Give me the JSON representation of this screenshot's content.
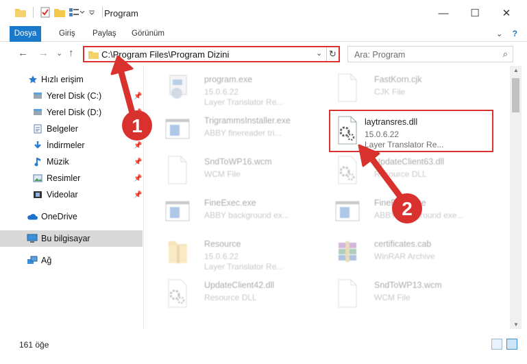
{
  "window": {
    "title": "Program",
    "minimize_glyph": "—",
    "maximize_glyph": "☐",
    "close_glyph": "✕"
  },
  "ribbon": {
    "tabs": [
      "Dosya",
      "Giriş",
      "Paylaş",
      "Görünüm"
    ],
    "expand_glyph": "⌄",
    "help_glyph": "?"
  },
  "nav": {
    "back_glyph": "←",
    "forward_glyph": "→",
    "history_glyph": "⌄",
    "up_glyph": "↑"
  },
  "address": {
    "path": "C:\\Program Files\\Program Dizini",
    "dropdown_glyph": "⌄",
    "refresh_glyph": "↻"
  },
  "search": {
    "placeholder": "Ara: Program",
    "icon_glyph": "⌕"
  },
  "sidebar": {
    "items": [
      {
        "label": "Hızlı erişim",
        "icon": "star-icon"
      },
      {
        "label": "Yerel Disk (C:)",
        "icon": "drive-icon"
      },
      {
        "label": "Yerel Disk (D:)",
        "icon": "drive-icon"
      },
      {
        "label": "Belgeler",
        "icon": "documents-icon"
      },
      {
        "label": "İndirmeler",
        "icon": "download-icon"
      },
      {
        "label": "Müzik",
        "icon": "music-icon"
      },
      {
        "label": "Resimler",
        "icon": "pictures-icon"
      },
      {
        "label": "Videolar",
        "icon": "videos-icon"
      },
      {
        "label": "OneDrive",
        "icon": "cloud-icon"
      },
      {
        "label": "Bu bilgisayar",
        "icon": "computer-icon"
      },
      {
        "label": "Ağ",
        "icon": "network-icon"
      }
    ]
  },
  "files": [
    {
      "name": "program.exe",
      "line2": "15.0.6.22",
      "line3": "Layer Translator Re...",
      "icon": "exe-icon"
    },
    {
      "name": "FastKorn.cjk",
      "line2": "CJK File",
      "line3": "",
      "icon": "blank-file-icon"
    },
    {
      "name": "TrigrammsInstaller.exe",
      "line2": "ABBY finereader tri...",
      "line3": "",
      "icon": "window-icon"
    },
    {
      "name": "laytransres.dll",
      "line2": "15.0.6.22",
      "line3": "Layer Translator Re...",
      "icon": "dll-gear-icon"
    },
    {
      "name": "SndToWP16.wcm",
      "line2": "WCM File",
      "line3": "",
      "icon": "blank-file-icon"
    },
    {
      "name": "UpdateClient63.dll",
      "line2": "Resource DLL",
      "line3": "",
      "icon": "dll-gear-icon"
    },
    {
      "name": "FineExec.exe",
      "line2": "ABBY background ex...",
      "line3": "",
      "icon": "window-icon"
    },
    {
      "name": "FineExec.exe",
      "line2": "ABBY background exe...",
      "line3": "",
      "icon": "window-icon"
    },
    {
      "name": "Resource",
      "line2": "15.0.6.22",
      "line3": "Layer Translator Re...",
      "icon": "zip-folder-icon"
    },
    {
      "name": "certificates.cab",
      "line2": "WinRAR Archive",
      "line3": "",
      "icon": "archive-icon"
    },
    {
      "name": "UpdateClient42.dll",
      "line2": "Resource DLL",
      "line3": "",
      "icon": "dll-gear-icon"
    },
    {
      "name": "SndToWP13.wcm",
      "line2": "WCM File",
      "line3": "",
      "icon": "blank-file-icon"
    }
  ],
  "status": {
    "count": "161 öğe"
  },
  "annotations": {
    "badge1": "1",
    "badge2": "2",
    "color": "#d9322e"
  }
}
